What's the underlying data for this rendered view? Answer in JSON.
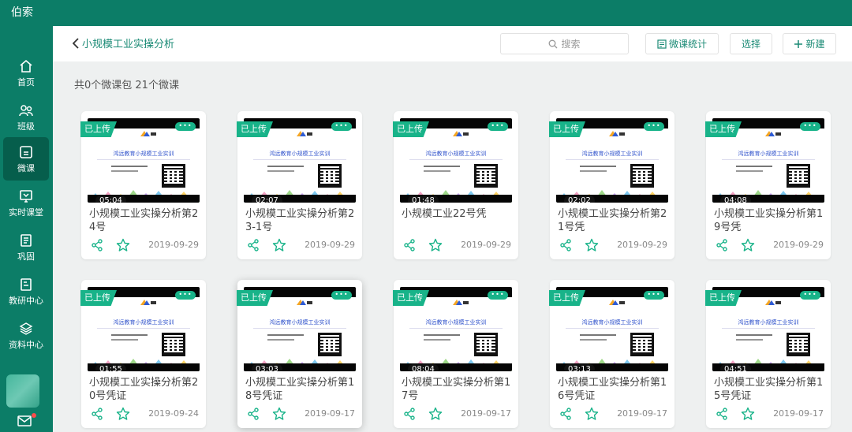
{
  "app": {
    "title": "伯索"
  },
  "sidebar": {
    "items": [
      {
        "label": "首页",
        "icon": "home-icon"
      },
      {
        "label": "班级",
        "icon": "users-icon"
      },
      {
        "label": "微课",
        "icon": "video-icon",
        "active": true
      },
      {
        "label": "实时课堂",
        "icon": "live-class-icon"
      },
      {
        "label": "巩固",
        "icon": "book-icon"
      },
      {
        "label": "教研中心",
        "icon": "research-icon"
      },
      {
        "label": "资料中心",
        "icon": "layers-icon"
      }
    ]
  },
  "header": {
    "back_title": "小规模工业实操分析",
    "search_placeholder": "搜索",
    "stats_label": "微课统计",
    "select_label": "选择",
    "new_label": "新建"
  },
  "summary": {
    "text": "共0个微课包   21个微课"
  },
  "thumbnail_title": "鸿远教育小规模工业实训",
  "status_badge": "已上传",
  "more_label": "•••",
  "cards": [
    {
      "title": "小规模工业实操分析第24号",
      "duration": "05:04",
      "date": "2019-09-29"
    },
    {
      "title": "小规模工业实操分析第23-1号",
      "duration": "02:07",
      "date": "2019-09-29"
    },
    {
      "title": "小规模工业22号凭",
      "duration": "01:48",
      "date": "2019-09-29"
    },
    {
      "title": "小规模工业实操分析第21号凭",
      "duration": "02:02",
      "date": "2019-09-29"
    },
    {
      "title": "小规模工业实操分析第19号凭",
      "duration": "04:08",
      "date": "2019-09-29"
    },
    {
      "title": "小规模工业实操分析第20号凭证",
      "duration": "01:55",
      "date": "2019-09-24"
    },
    {
      "title": "小规模工业实操分析第18号凭证",
      "duration": "03:03",
      "date": "2019-09-17"
    },
    {
      "title": "小规模工业实操分析第17号",
      "duration": "08:04",
      "date": "2019-09-17"
    },
    {
      "title": "小规模工业实操分析第16号凭证",
      "duration": "03:13",
      "date": "2019-09-17"
    },
    {
      "title": "小规模工业实操分析第15号凭证",
      "duration": "04:51",
      "date": "2019-09-17"
    }
  ],
  "colors": {
    "primary": "#0c7d67",
    "accent": "#18b389",
    "link": "#1a8a75"
  }
}
